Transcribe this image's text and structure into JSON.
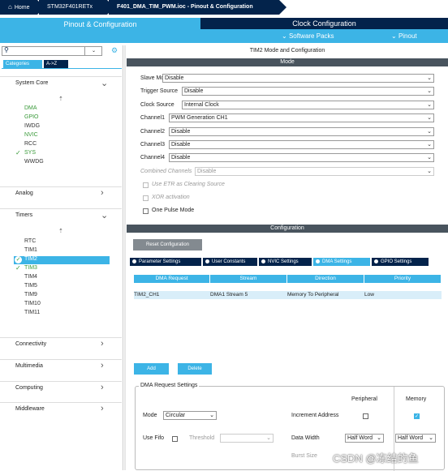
{
  "breadcrumb": {
    "home": "Home",
    "chip": "STM32F401RETx",
    "file": "F401_DMA_TIM_PWM.ioc - Pinout & Configuration"
  },
  "tabs": {
    "pinout": "Pinout & Configuration",
    "clock": "Clock Configuration",
    "software_packs": "Software Packs",
    "pinout_menu": "Pinout"
  },
  "left": {
    "search_placeholder": "",
    "categories_tab": "Categories",
    "az_tab": "A->Z",
    "sections": {
      "system_core": "System Core",
      "analog": "Analog",
      "timers": "Timers",
      "connectivity": "Connectivity",
      "multimedia": "Multimedia",
      "computing": "Computing",
      "middleware": "Middleware"
    },
    "system_items": [
      {
        "label": "DMA",
        "state": "green"
      },
      {
        "label": "GPIO",
        "state": "green"
      },
      {
        "label": "IWDG",
        "state": "normal"
      },
      {
        "label": "NVIC",
        "state": "green"
      },
      {
        "label": "RCC",
        "state": "normal"
      },
      {
        "label": "SYS",
        "state": "checked"
      },
      {
        "label": "WWDG",
        "state": "normal"
      }
    ],
    "timer_items": [
      {
        "label": "RTC",
        "state": "normal"
      },
      {
        "label": "TIM1",
        "state": "normal"
      },
      {
        "label": "TIM2",
        "state": "selected"
      },
      {
        "label": "TIM3",
        "state": "checked"
      },
      {
        "label": "TIM4",
        "state": "normal"
      },
      {
        "label": "TIM5",
        "state": "normal"
      },
      {
        "label": "TIM9",
        "state": "normal"
      },
      {
        "label": "TIM10",
        "state": "normal"
      },
      {
        "label": "TIM11",
        "state": "normal"
      }
    ]
  },
  "right": {
    "title": "TIM2 Mode and Configuration",
    "mode_header": "Mode",
    "mode_fields": [
      {
        "label": "Slave Mode",
        "value": "Disable",
        "disabled": false
      },
      {
        "label": "Trigger Source",
        "value": "Disable",
        "disabled": false
      },
      {
        "label": "Clock Source",
        "value": "Internal Clock",
        "disabled": false
      },
      {
        "label": "Channel1",
        "value": "PWM Generation CH1",
        "disabled": false
      },
      {
        "label": "Channel2",
        "value": "Disable",
        "disabled": false
      },
      {
        "label": "Channel3",
        "value": "Disable",
        "disabled": false
      },
      {
        "label": "Channel4",
        "value": "Disable",
        "disabled": false
      },
      {
        "label": "Combined Channels",
        "value": "Disable",
        "disabled": true
      }
    ],
    "checkboxes": [
      {
        "label": "Use ETR as Clearing Source",
        "disabled": true
      },
      {
        "label": "XOR activation",
        "disabled": true
      },
      {
        "label": "One Pulse Mode",
        "disabled": false
      }
    ],
    "config_header": "Configuration",
    "reset_button": "Reset Configuration",
    "config_tabs": [
      {
        "label": "Parameter Settings",
        "active": false
      },
      {
        "label": "User Constants",
        "active": false
      },
      {
        "label": "NVIC Settings",
        "active": false
      },
      {
        "label": "DMA Settings",
        "active": true
      },
      {
        "label": "GPIO Settings",
        "active": false
      }
    ],
    "dma_columns": [
      "DMA Request",
      "Stream",
      "Direction",
      "Priority"
    ],
    "dma_rows": [
      [
        "TIM2_CH1",
        "DMA1 Stream 5",
        "Memory To Peripheral",
        "Low"
      ]
    ],
    "add_button": "Add",
    "delete_button": "Delete",
    "request_settings": {
      "legend": "DMA Request Settings",
      "peripheral_label": "Peripheral",
      "memory_label": "Memory",
      "mode_label": "Mode",
      "mode_value": "Circular",
      "increment_label": "Increment Address",
      "peripheral_increment": false,
      "memory_increment": true,
      "use_fifo_label": "Use Fifo",
      "threshold_label": "Threshold",
      "threshold_value": "",
      "data_width_label": "Data Width",
      "peripheral_width": "Half Word",
      "memory_width": "Half Word",
      "burst_size_label": "Burst Size"
    }
  },
  "watermark": "CSDN @冻结的鱼",
  "colors": {
    "accent": "#3cb4e6",
    "dark": "#03234b",
    "header": "#49545e",
    "green": "#3a9a3a"
  }
}
